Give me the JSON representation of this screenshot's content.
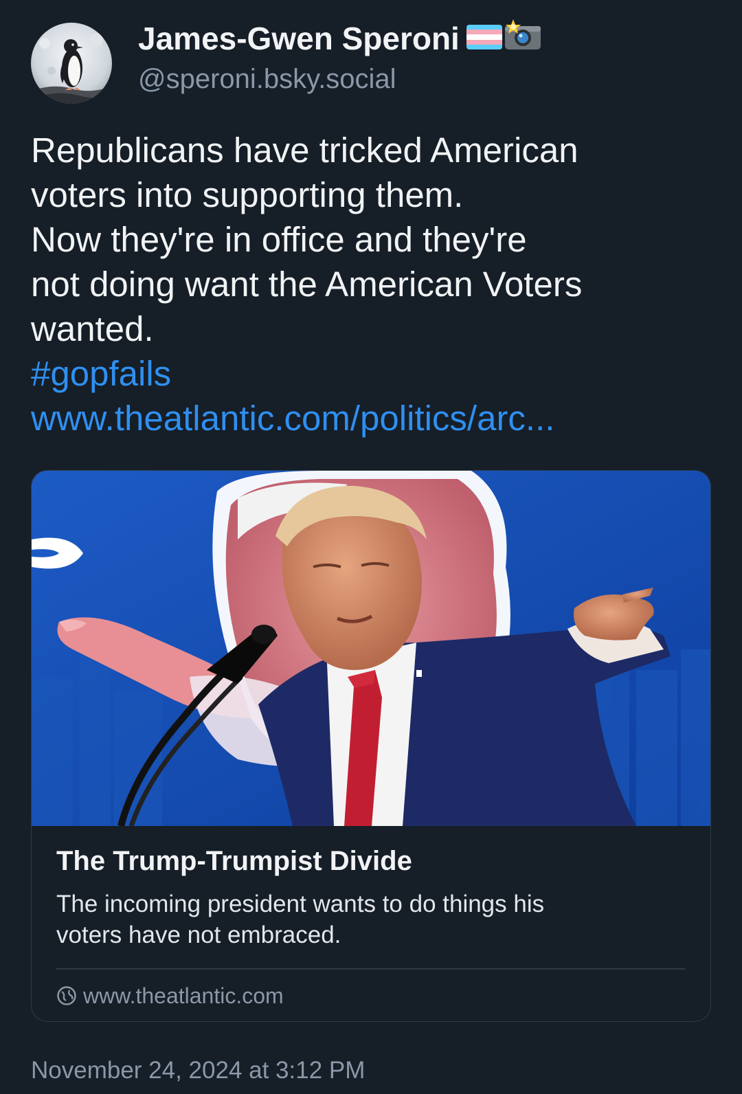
{
  "author": {
    "display_name": "James-Gwen Speroni",
    "handle": "@speroni.bsky.social",
    "badges": [
      "transgender-flag-icon",
      "camera-flash-icon"
    ]
  },
  "post": {
    "lines": [
      "Republicans have tricked American",
      "voters into supporting them.",
      "Now they're in office and they're",
      "not doing want the American Voters",
      "wanted."
    ],
    "hashtag": "#gopfails",
    "link_text": "www.theatlantic.com/politics/arc..."
  },
  "link_card": {
    "title": "The Trump-Trumpist Divide",
    "description_lines": [
      "The incoming president wants to do things his",
      "voters have not embraced."
    ],
    "domain": "www.theatlantic.com"
  },
  "timestamp": "November 24, 2024 at 3:12 PM",
  "colors": {
    "background": "#161e27",
    "text": "#f1f3f5",
    "muted": "#8a98a8",
    "link": "#2f8ff0",
    "border": "#2e3a47"
  }
}
